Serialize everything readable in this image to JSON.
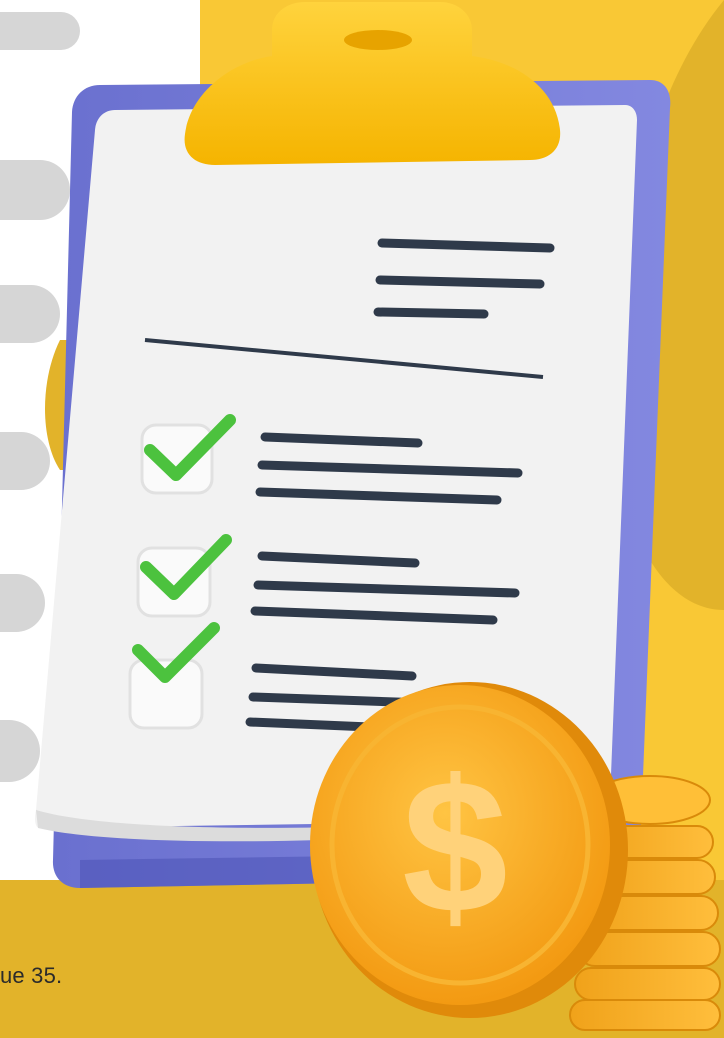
{
  "caption": "ue 35.",
  "icons": {
    "clipboard": "clipboard-icon",
    "checkmark": "checkmark-icon",
    "coin": "dollar-coin-icon",
    "coin_symbol": "$"
  },
  "colors": {
    "background_yellow": "#f6c632",
    "background_mustard": "#e2b32a",
    "clipboard_board": "#7178d3",
    "clip": "#ffc61a",
    "paper": "#f2f2f2",
    "text_line": "#2f3a4a",
    "check_green": "#4cc23e",
    "coin_gold": "#f7a81f"
  }
}
